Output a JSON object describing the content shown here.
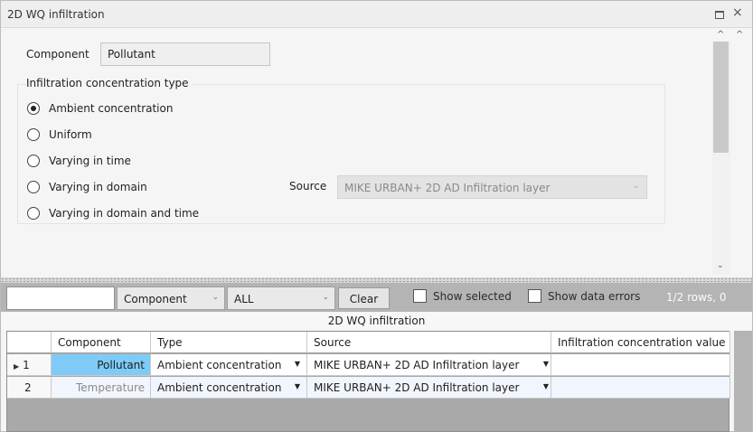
{
  "window": {
    "title": "2D WQ infiltration",
    "restore_icon": "restore-icon",
    "close_label": "×"
  },
  "form": {
    "component_label": "Component",
    "component_value": "Pollutant",
    "group_title": "Infiltration concentration type",
    "options": [
      {
        "label": "Ambient concentration",
        "checked": true
      },
      {
        "label": "Uniform",
        "checked": false
      },
      {
        "label": "Varying in time",
        "checked": false
      },
      {
        "label": "Varying in domain",
        "checked": false
      },
      {
        "label": "Varying in domain and time",
        "checked": false
      }
    ],
    "source_label": "Source",
    "source_value": "MIKE URBAN+ 2D AD Infiltration layer",
    "scroll_up_glyph": "^",
    "scroll_down_glyph": "⌄"
  },
  "toolbar": {
    "filter_field": "Component",
    "filter_value": "ALL",
    "clear_label": "Clear",
    "show_selected_label": "Show selected",
    "show_errors_label": "Show data errors",
    "row_count": "1/2 rows, 0"
  },
  "grid": {
    "title": "2D WQ infiltration",
    "columns": [
      "",
      "Component",
      "Type",
      "Source",
      "Infiltration concentration value"
    ],
    "rows": [
      {
        "num": "1",
        "component": "Pollutant",
        "type": "Ambient concentration",
        "source": "MIKE URBAN+ 2D AD Infiltration layer",
        "value": ""
      },
      {
        "num": "2",
        "component": "Temperature",
        "type": "Ambient concentration",
        "source": "MIKE URBAN+ 2D AD Infiltration layer",
        "value": ""
      }
    ]
  },
  "colors": {
    "selected_cell": "#7ecbf8",
    "toolbar_bg": "#b4b4b4",
    "grid_empty_bg": "#a9a9a9"
  }
}
